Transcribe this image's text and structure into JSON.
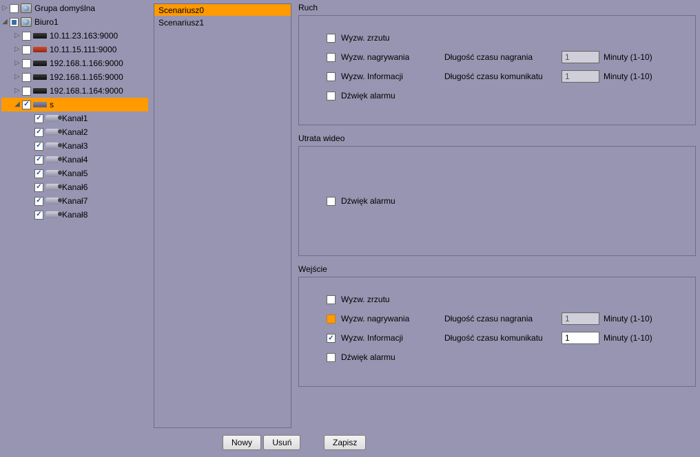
{
  "tree": {
    "group_default": "Grupa domyślna",
    "biuro": "Biuro1",
    "d1": "10.11.23.163:9000",
    "d2": "10.11.15.111:9000",
    "d3": "192.168.1.166:9000",
    "d4": "192.168.1.165:9000",
    "d5": "192.168.1.164:9000",
    "s_label": "s",
    "ch1": "Kanał1",
    "ch2": "Kanał2",
    "ch3": "Kanał3",
    "ch4": "Kanał4",
    "ch5": "Kanał5",
    "ch6": "Kanał6",
    "ch7": "Kanał7",
    "ch8": "Kanał8"
  },
  "scenarios": {
    "s0": "Scenariusz0",
    "s1": "Scenariusz1"
  },
  "groups": {
    "ruch": {
      "title": "Ruch",
      "snapshot": "Wyzw. zrzutu",
      "record": "Wyzw. nagrywania",
      "record_len_label": "Długość czasu nagrania",
      "record_len_val": "1",
      "info": "Wyzw. Informacji",
      "msg_len_label": "Długość czasu komunikatu",
      "msg_len_val": "1",
      "alarm": "Dźwięk alarmu",
      "unit": "Minuty (1-10)"
    },
    "videoloss": {
      "title": "Utrata wideo",
      "alarm": "Dźwięk alarmu"
    },
    "input": {
      "title": "Wejście",
      "snapshot": "Wyzw. zrzutu",
      "record": "Wyzw. nagrywania",
      "record_len_label": "Długość czasu nagrania",
      "record_len_val": "1",
      "info": "Wyzw. Informacji",
      "msg_len_label": "Długość czasu komunikatu",
      "msg_len_val": "1",
      "alarm": "Dźwięk alarmu",
      "unit": "Minuty (1-10)"
    }
  },
  "buttons": {
    "new": "Nowy",
    "delete": "Usuń",
    "save": "Zapisz"
  }
}
